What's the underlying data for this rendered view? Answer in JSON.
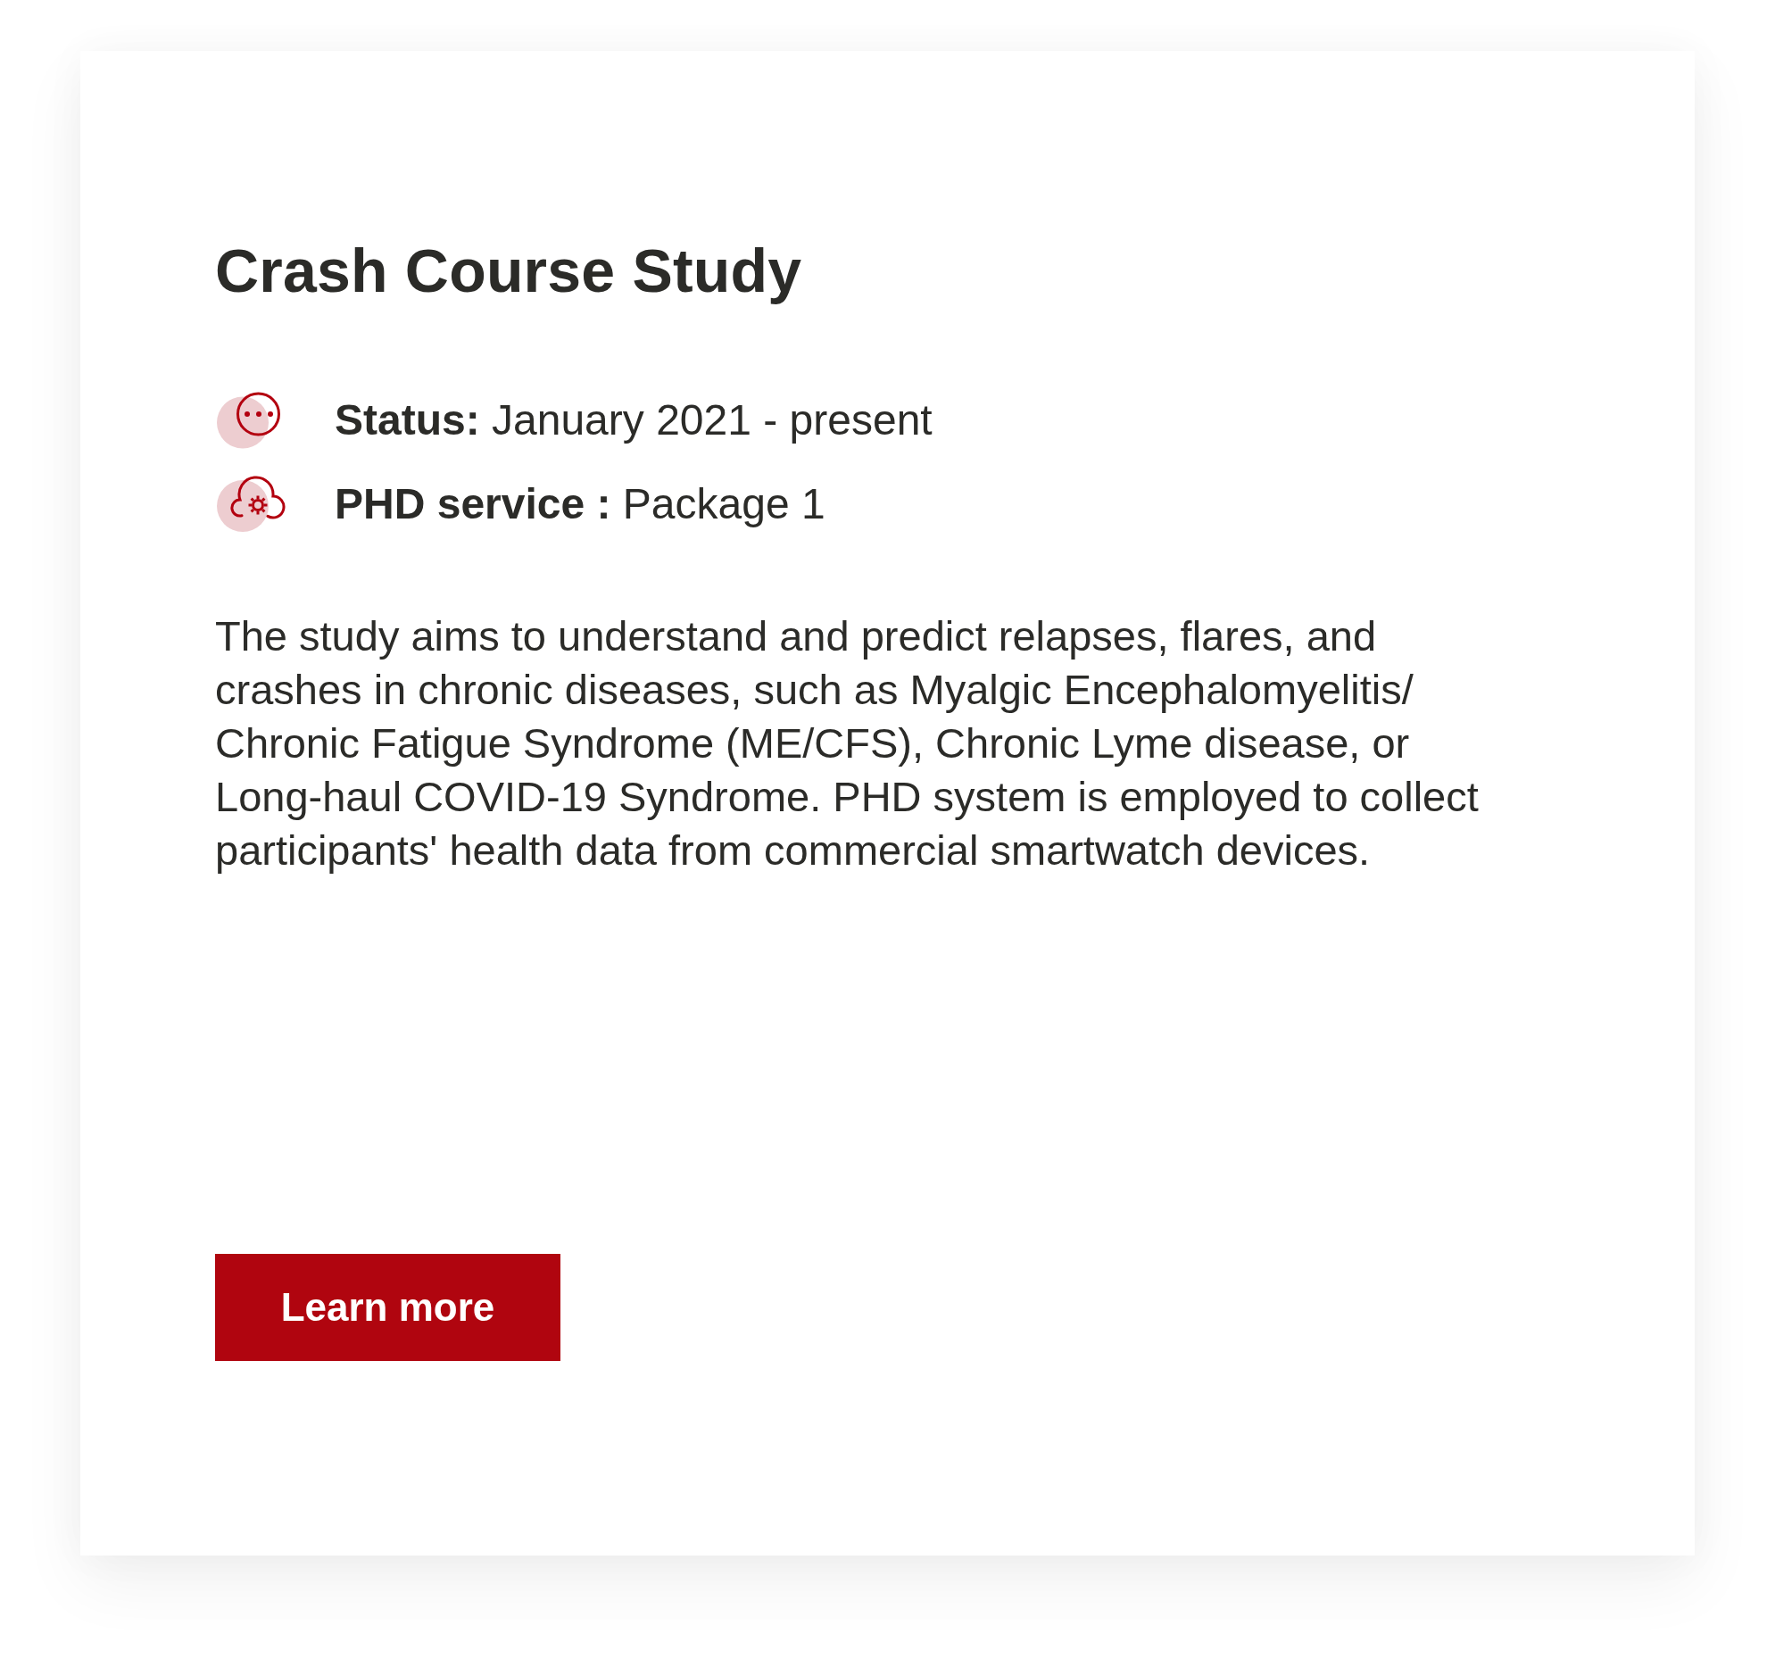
{
  "card": {
    "title": "Crash Course Study",
    "meta": [
      {
        "kind": "status",
        "text": "**Status:** January 2021 - present"
      },
      {
        "kind": "service",
        "text": "**PHD service :** Package 1"
      }
    ],
    "description": "The study aims to understand and predict relapses, flares, and crashes in chronic diseases, such as Myalgic Encephalomyelitis/ Chronic Fatigue Syndrome (ME/CFS), Chronic Lyme disease, or Long-haul COVID-19 Syndrome. PHD system is employed to collect participants' health data from commercial smartwatch devices.",
    "button": {
      "label": "Learn more"
    }
  }
}
